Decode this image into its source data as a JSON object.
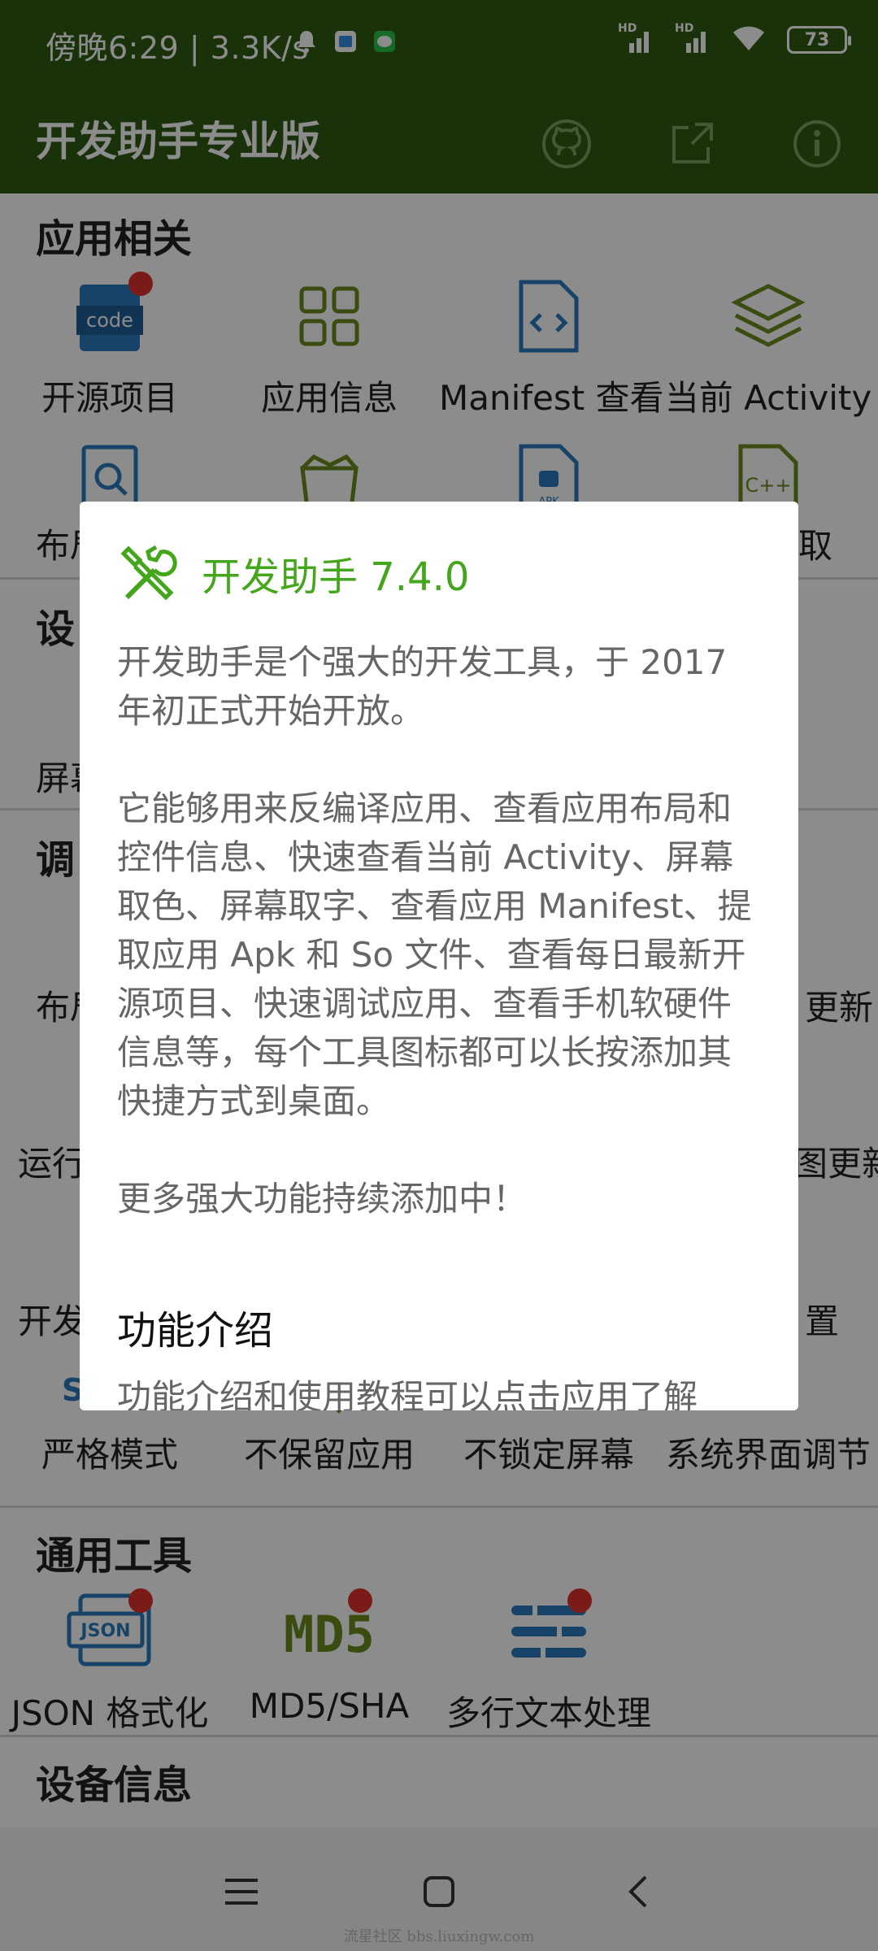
{
  "status_bar": {
    "time": "傍晚6:29 | 3.3K/s",
    "signal_labels": [
      "HD",
      "HD"
    ],
    "battery": "73",
    "icons": [
      "bell-icon",
      "gallery-icon",
      "message-icon",
      "signal-icon",
      "signal-icon",
      "wifi-icon"
    ]
  },
  "app_bar": {
    "title": "开发助手专业版",
    "actions": [
      "github-icon",
      "share-icon",
      "info-icon"
    ]
  },
  "sections": {
    "apps": {
      "title": "应用相关"
    },
    "settings": {
      "title": "设"
    },
    "debug": {
      "title": "调"
    },
    "tools": {
      "title": "通用工具"
    },
    "device": {
      "title": "设备信息"
    }
  },
  "tiles": {
    "open_source": "开源项目",
    "app_info": "应用信息",
    "manifest": "Manifest 查看",
    "current_activity": "当前 Activity",
    "layout_partial": "布局",
    "extract_partial": "取",
    "screen_partial": "屏幕",
    "layout2_partial": "布局",
    "update_partial": "更新",
    "run_partial": "运行",
    "map_update_partial": "图更新",
    "dev_partial": "开发",
    "config_partial": "置",
    "strict_mode": "严格模式",
    "dont_keep": "不保留应用",
    "no_lock": "不锁定屏幕",
    "system_ui": "系统界面调节",
    "json": "JSON 格式化",
    "md5": "MD5/SHA",
    "multiline": "多行文本处理",
    "code_badge": "code",
    "json_badge": "JSON",
    "md5_badge": "MD5",
    "strict_badge": "Strict",
    "apk_badge": "APK",
    "cpp_badge": "C++"
  },
  "dialog": {
    "title": "开发助手 7.4.0",
    "para1": "开发助手是个强大的开发工具，于 2017 年初正式开始开放。",
    "para2": "它能够用来反编译应用、查看应用布局和控件信息、快速查看当前 Activity、屏幕取色、屏幕取字、查看应用 Manifest、提取应用 Apk 和 So 文件、查看每日最新开源项目、快速调试应用、查看手机软硬件信息等，每个工具图标都可以长按添加其快捷方式到桌面。",
    "para3": "更多强大功能持续添加中！",
    "subheading": "功能介绍",
    "cut_line": "功能介绍和使用教程可以点击应用了解"
  },
  "nav_bar": {
    "icons": [
      "menu-icon",
      "home-icon",
      "back-icon"
    ]
  },
  "watermark": "流星社区 bbs.liuxingw.com",
  "colors": {
    "app_bar": "#2f5b13",
    "accent_green": "#43a61b",
    "blue": "#2a7bbf",
    "olive": "#6b8a1e",
    "red_dot": "#e0322b"
  }
}
